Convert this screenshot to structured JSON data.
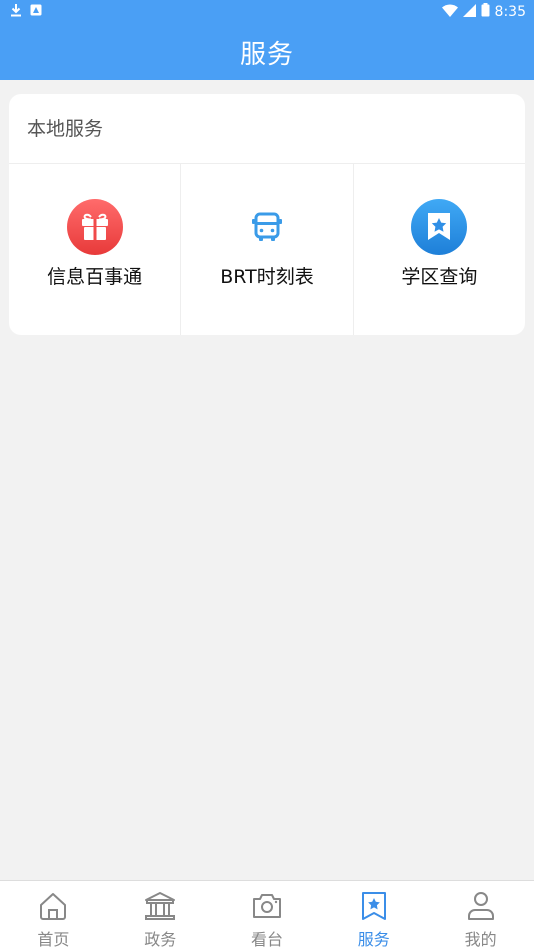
{
  "status_bar": {
    "time": "8:35",
    "icons": [
      "download-icon",
      "notification-icon",
      "wifi-icon",
      "signal-icon",
      "battery-icon"
    ]
  },
  "header": {
    "title": "服务"
  },
  "local_services": {
    "title": "本地服务",
    "items": [
      {
        "label": "信息百事通",
        "icon": "gift-icon",
        "color": "#f04a4a"
      },
      {
        "label": "BRT时刻表",
        "icon": "bus-icon",
        "color": "#3a9be8"
      },
      {
        "label": "学区查询",
        "icon": "bookmark-star-icon",
        "color": "#2f8fe6"
      }
    ]
  },
  "tabbar": {
    "items": [
      {
        "label": "首页",
        "icon": "home-icon",
        "active": false
      },
      {
        "label": "政务",
        "icon": "government-icon",
        "active": false
      },
      {
        "label": "看台",
        "icon": "camera-icon",
        "active": false
      },
      {
        "label": "服务",
        "icon": "bookmark-star-icon",
        "active": true
      },
      {
        "label": "我的",
        "icon": "user-icon",
        "active": false
      }
    ]
  },
  "colors": {
    "primary": "#4a9ff5",
    "active_tab": "#3b8ee8",
    "background": "#f2f2f2"
  }
}
